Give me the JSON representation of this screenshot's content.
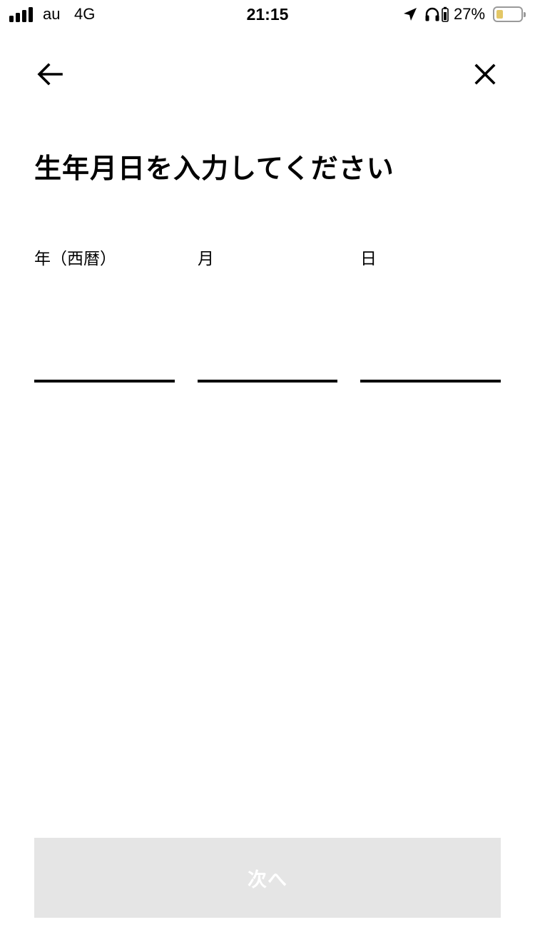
{
  "status_bar": {
    "carrier": "au",
    "network": "4G",
    "time": "21:15",
    "battery_percent": "27%",
    "battery_level": 0.27,
    "battery_color": "#e3c766",
    "signal_bars": 4,
    "icons": [
      "signal-icon",
      "location-arrow-icon",
      "headphones-icon",
      "charging-icon",
      "battery-icon"
    ]
  },
  "nav": {
    "back_icon": "arrow-left-icon",
    "close_icon": "close-icon"
  },
  "title": "生年月日を入力してください",
  "fields": {
    "year": {
      "label": "年（西暦）",
      "value": ""
    },
    "month": {
      "label": "月",
      "value": ""
    },
    "day": {
      "label": "日",
      "value": ""
    }
  },
  "next_button": {
    "label": "次へ",
    "disabled": true,
    "background": "#e5e5e5",
    "text_color": "#ffffff"
  }
}
